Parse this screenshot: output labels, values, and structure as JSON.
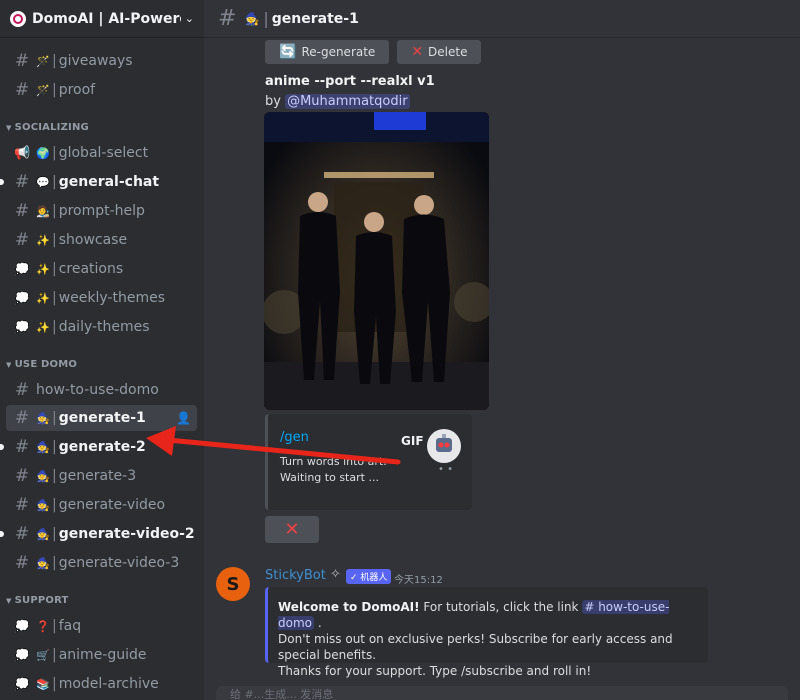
{
  "server": {
    "name": "DomoAI | AI-Powered A",
    "chevron_icon": "chevron-down-icon"
  },
  "sidebar": {
    "channels_top": [
      {
        "emoji": "🪄",
        "label": "giveaways",
        "type": "text"
      },
      {
        "emoji": "🪄",
        "label": "proof",
        "type": "text"
      }
    ],
    "categories": [
      {
        "label": "SOCIALIZING"
      },
      {
        "label": "USE DOMO"
      },
      {
        "label": "SUPPORT"
      }
    ],
    "socializing": [
      {
        "emoji": "🌍",
        "label": "global-select",
        "type": "announcement"
      },
      {
        "emoji": "💬",
        "label": "general-chat",
        "type": "text",
        "unread": true
      },
      {
        "emoji": "🧑‍🎨",
        "label": "prompt-help",
        "type": "text"
      },
      {
        "emoji": "✨",
        "label": "showcase",
        "type": "text"
      },
      {
        "emoji": "✨",
        "label": "creations",
        "type": "forum"
      },
      {
        "emoji": "✨",
        "label": "weekly-themes",
        "type": "forum"
      },
      {
        "emoji": "✨",
        "label": "daily-themes",
        "type": "forum"
      }
    ],
    "use_domo": [
      {
        "emoji": "",
        "label": "how-to-use-domo",
        "type": "text"
      },
      {
        "emoji": "🧙",
        "label": "generate-1",
        "type": "text",
        "active": true
      },
      {
        "emoji": "🧙",
        "label": "generate-2",
        "type": "text",
        "unread": true
      },
      {
        "emoji": "🧙",
        "label": "generate-3",
        "type": "text"
      },
      {
        "emoji": "🧙",
        "label": "generate-video",
        "type": "text"
      },
      {
        "emoji": "🧙",
        "label": "generate-video-2",
        "type": "text",
        "unread": true
      },
      {
        "emoji": "🧙",
        "label": "generate-video-3",
        "type": "text"
      }
    ],
    "support": [
      {
        "emoji": "❓",
        "label": "faq",
        "type": "forum"
      },
      {
        "emoji": "🛒",
        "label": "anime-guide",
        "type": "forum"
      },
      {
        "emoji": "📚",
        "label": "model-archive",
        "type": "forum"
      }
    ]
  },
  "channel_header": {
    "emoji": "🧙",
    "title": "generate-1"
  },
  "message": {
    "regenerate_label": "Re-generate",
    "delete_label": "Delete",
    "prompt": "anime --port --realxl v1",
    "by_prefix": "by",
    "author_mention": "@Muhammatqodir"
  },
  "embed": {
    "command": "/gen",
    "description_line1": "Turn words into art.",
    "description_line2": "Waiting to start ...",
    "gif_label": "GIF"
  },
  "sticky": {
    "author": "StickyBot",
    "bot_badge": "✓ 机器人",
    "time": "今天15:12",
    "welcome_bold": "Welcome to DomoAI!",
    "line1_text": " For tutorials, click the link ",
    "channel_link": "# how-to-use-domo",
    "line1_end": " .",
    "line2": "Don't miss out on exclusive perks! Subscribe for early access and special benefits.",
    "line3": "Thanks for your support. Type /subscribe and roll in!"
  },
  "composer": {
    "placeholder": "给 #...生成... 发消息"
  },
  "colors": {
    "arrow": "#e8251a",
    "accent": "#5865f2",
    "link": "#00a8fc"
  }
}
